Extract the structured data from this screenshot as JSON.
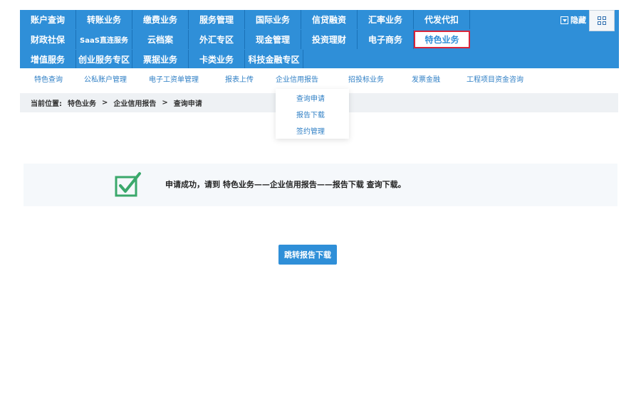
{
  "nav": {
    "row1": [
      "账户查询",
      "转账业务",
      "缴费业务",
      "服务管理",
      "国际业务",
      "信贷融资",
      "汇率业务",
      "代发代扣"
    ],
    "row2": [
      "财政社保",
      "SaaS直连服务",
      "云档案",
      "外汇专区",
      "现金管理",
      "投资理财",
      "电子商务",
      "特色业务"
    ],
    "row3": [
      "增值服务",
      "创业服务专区",
      "票据业务",
      "卡类业务",
      "科技金融专区"
    ],
    "hide_label": "隐藏",
    "selected": "特色业务"
  },
  "subnav": [
    "特色查询",
    "公私账户管理",
    "电子工资单管理",
    "报表上传",
    "企业信用报告",
    "招投标业务",
    "发票金融",
    "工程项目资金咨询"
  ],
  "breadcrumb": {
    "label": "当前位置:",
    "items": [
      "特色业务",
      "企业信用报告",
      "查询申请"
    ],
    "sep": ">"
  },
  "dropdown": [
    "查询申请",
    "报告下载",
    "签约管理"
  ],
  "message": {
    "text": "申请成功，请到 特色业务——企业信用报告——报告下载 查询下载。"
  },
  "jump_button": "跳转报告下载",
  "colors": {
    "accent": "#2f8fd8",
    "selected_border": "#d9263a",
    "check": "#3aa86b"
  },
  "icons": {
    "check": "checkbox-check-icon",
    "grid": "grid-icon",
    "hide": "collapse-icon"
  }
}
